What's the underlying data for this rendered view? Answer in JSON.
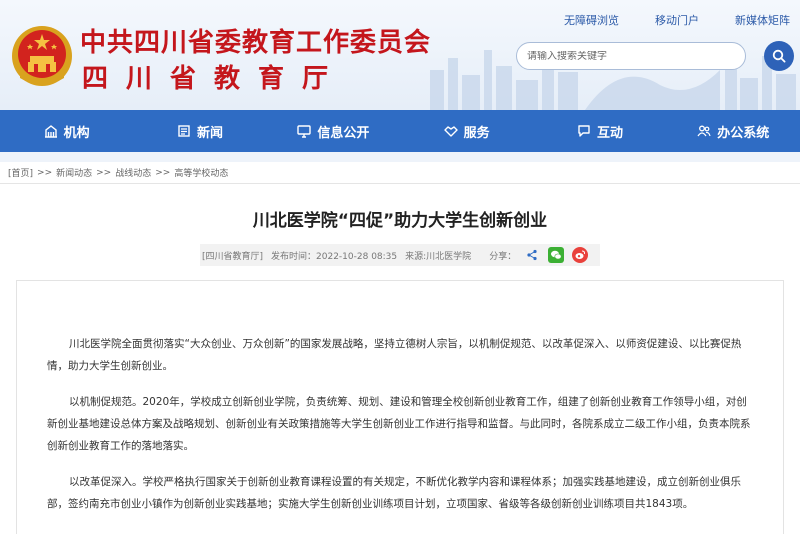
{
  "header": {
    "title": "中共四川省委教育工作委员会",
    "subtitle": "四川省教育厅",
    "top_links": [
      "无障碍浏览",
      "移动门户",
      "新媒体矩阵"
    ],
    "search_placeholder": "请输入搜索关键字"
  },
  "nav": {
    "items": [
      {
        "label": "机构",
        "icon": "building-icon"
      },
      {
        "label": "新闻",
        "icon": "newspaper-icon"
      },
      {
        "label": "信息公开",
        "icon": "monitor-icon"
      },
      {
        "label": "服务",
        "icon": "handshake-icon"
      },
      {
        "label": "互动",
        "icon": "chat-icon"
      },
      {
        "label": "办公系统",
        "icon": "users-icon"
      }
    ]
  },
  "breadcrumb": {
    "items": [
      "[首页]",
      "新闻动态",
      "战线动态",
      "高等学校动态"
    ],
    "separator": ">>"
  },
  "article": {
    "title": "川北医学院“四促”助力大学生创新创业",
    "source_tag": "[四川省教育厅]",
    "published": "发布时间：2022-10-28 08:35",
    "origin": "来源:川北医学院",
    "share_label": "分享：",
    "paragraphs": [
      "川北医学院全面贯彻落实“大众创业、万众创新”的国家发展战略，坚持立德树人宗旨，以机制促规范、以改革促深入、以师资促建设、以比赛促热情，助力大学生创新创业。",
      "以机制促规范。2020年，学校成立创新创业学院，负责统筹、规划、建设和管理全校创新创业教育工作，组建了创新创业教育工作领导小组，对创新创业基地建设总体方案及战略规划、创新创业有关政策措施等大学生创新创业工作进行指导和监督。与此同时，各院系成立二级工作小组，负责本院系创新创业教育工作的落地落实。",
      "以改革促深入。学校严格执行国家关于创新创业教育课程设置的有关规定，不断优化教学内容和课程体系；加强实践基地建设，成立创新创业俱乐部，签约南充市创业小镇作为创新创业实践基地；实施大学生创新创业训练项目计划，立项国家、省级等各级创新创业训练项目共1843项。"
    ]
  },
  "colors": {
    "brand_red": "#c4161c",
    "nav_blue": "#2f6cc4",
    "wechat_green": "#3cb034",
    "weibo_red": "#e9413c"
  }
}
